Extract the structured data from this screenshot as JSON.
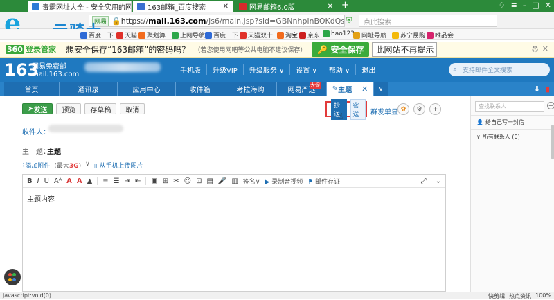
{
  "browser": {
    "tabs": [
      {
        "label": "毒霸网址大全 - 安全实用的网址",
        "state": "inactive"
      },
      {
        "label": "163邮箱_百度搜索",
        "state": "inactive"
      },
      {
        "label": "网易邮箱6.0版",
        "state": "active"
      }
    ],
    "new_tab": "+",
    "address": {
      "badge": "网易",
      "scheme": "https://",
      "domain": "mail.163.com",
      "path": "/js6/main.jsp?sid=GBNnhpinBOKdQseTjOnnzi"
    },
    "search_placeholder": "点此搜索",
    "logo_letter": "e",
    "logo_text": "云骑士",
    "colors": {
      "tabbar": "#2c8a3a",
      "mailblue": "#1f79c0",
      "send": "#3c9d4a",
      "highlight": "#e23b3b"
    }
  },
  "bookmarks": [
    "百度一下",
    "天猫",
    "聚划算",
    "上网导航",
    "百度一下",
    "天猫双十",
    "淘宝",
    "京东",
    "hao123",
    "网址导航",
    "苏宁易购",
    "唯品会"
  ],
  "security_bar": {
    "logo_num": "360",
    "logo": "登录管家",
    "question": "想安全保存“163邮箱”的密码吗？",
    "note": "（若您使用网吧等公共电脑不建议保存）",
    "save": "安全保存",
    "no_prompt": "此网站不再提示"
  },
  "mail_header": {
    "logo": "163",
    "sub1": "网易免费邮",
    "sub2": "mail.163.com",
    "links": [
      "手机版",
      "升级VIP",
      "升级服务 ∨",
      "设置 ∨",
      "帮助 ∨",
      "退出"
    ],
    "search_placeholder": "支持邮件全文搜索"
  },
  "nav_tabs": [
    {
      "label": "首页"
    },
    {
      "label": "通讯录"
    },
    {
      "label": "应用中心"
    },
    {
      "label": "收件箱"
    },
    {
      "label": "考拉海购"
    },
    {
      "label": "网易严选",
      "badge": "大促"
    },
    {
      "label": "主题",
      "active": true
    }
  ],
  "compose": {
    "send": "发送",
    "preview": "预览",
    "save_draft": "存草稿",
    "cancel": "取消",
    "cc": "抄送",
    "bcc": "密送",
    "group_send": "群发单显",
    "to_label": "收件人：",
    "subject_label": "主　题：",
    "subject_value": "主题",
    "attach": "添加附件",
    "attach_max_prefix": "(最大",
    "attach_max_value": "3G",
    "attach_max_suffix": ")",
    "mobile_upload": "从手机上传图片",
    "body": "主题内容",
    "toolbar_text": {
      "signature": "签名∨",
      "record": "录制音视频",
      "evidence": "邮件存证"
    }
  },
  "contacts": {
    "search_placeholder": "查找联系人",
    "self": "给自己写一封信",
    "all": "所有联系人 (0)"
  },
  "status_bar": {
    "left": "javascript:void(0)",
    "right": [
      "快剪辑",
      "热点资讯",
      "100%"
    ]
  }
}
